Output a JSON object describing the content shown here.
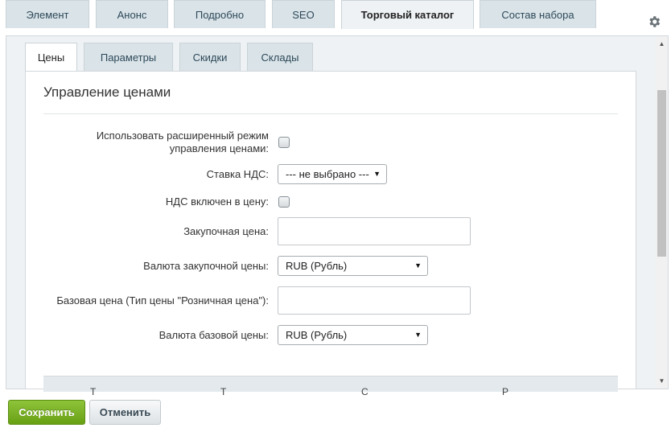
{
  "top_tabs": [
    {
      "label": "Элемент"
    },
    {
      "label": "Анонс"
    },
    {
      "label": "Подробно"
    },
    {
      "label": "SEO"
    },
    {
      "label": "Торговый каталог"
    },
    {
      "label": "Состав набора"
    }
  ],
  "active_top_tab": "Торговый каталог",
  "sub_tabs": [
    {
      "label": "Цены"
    },
    {
      "label": "Параметры"
    },
    {
      "label": "Скидки"
    },
    {
      "label": "Склады"
    }
  ],
  "active_sub_tab": "Цены",
  "section": {
    "title": "Управление ценами"
  },
  "form": {
    "extended_mode": {
      "label_line1": "Использовать расширенный режим",
      "label_line2": "управления ценами:",
      "checked": false
    },
    "vat_rate": {
      "label": "Ставка НДС:",
      "value": "--- не выбрано ---"
    },
    "vat_included": {
      "label": "НДС включен в цену:",
      "checked": false
    },
    "purchase_price": {
      "label": "Закупочная цена:",
      "value": ""
    },
    "purchase_currency": {
      "label": "Валюта закупочной цены:",
      "value": "RUB (Рубль)"
    },
    "base_price": {
      "label": "Базовая цена (Тип цены \"Розничная цена\"):",
      "value": ""
    },
    "base_currency": {
      "label": "Валюта базовой цены:",
      "value": "RUB (Рубль)"
    }
  },
  "table_headers": [
    "Т",
    "Т",
    "С",
    "Р"
  ],
  "buttons": {
    "save": "Сохранить",
    "cancel": "Отменить"
  },
  "icons": {
    "settings": "gear-icon",
    "dropdown": "chevron-down-icon"
  },
  "colors": {
    "save_button": "#76b02a",
    "tab_bg": "#d9e3e8",
    "frame_bg": "#eef2f4"
  }
}
